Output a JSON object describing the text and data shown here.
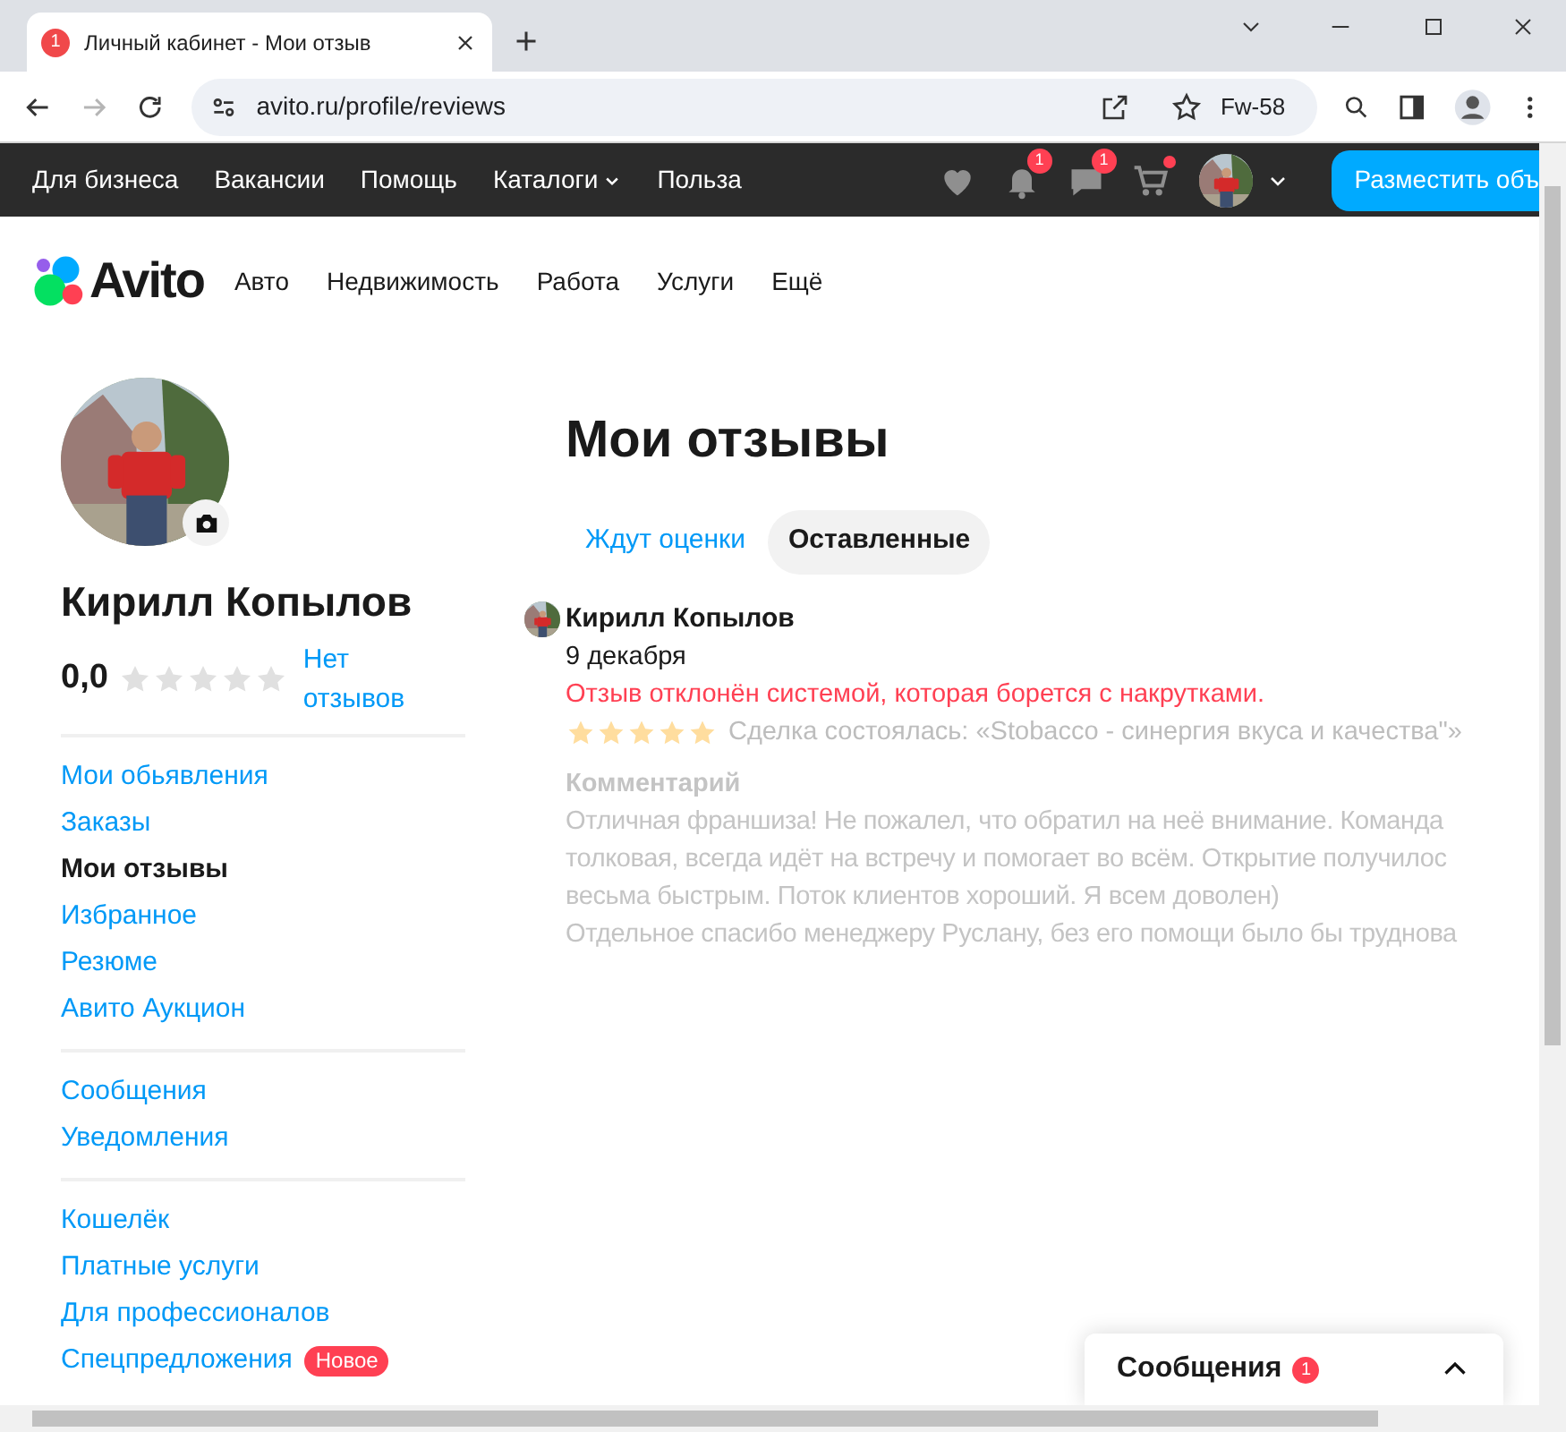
{
  "browser": {
    "tab": {
      "title": "Личный кабинет - Мои отзыв",
      "badge": "1"
    },
    "forward_disabled": true,
    "url": "avito.ru/profile/reviews",
    "profile_label": "Fw-58"
  },
  "topbar": {
    "links": [
      {
        "label": "Для бизнеса",
        "dropdown": false
      },
      {
        "label": "Вакансии",
        "dropdown": false
      },
      {
        "label": "Помощь",
        "dropdown": false
      },
      {
        "label": "Каталоги",
        "dropdown": true
      },
      {
        "label": "Польза",
        "dropdown": false
      }
    ],
    "icons": [
      {
        "kind": "heart"
      },
      {
        "kind": "bell",
        "badge": "1"
      },
      {
        "kind": "chat",
        "badge": "1"
      },
      {
        "kind": "cart",
        "dot": true
      }
    ],
    "post_button": "Разместить объ"
  },
  "header": {
    "logo": "Avito",
    "categories": [
      "Авто",
      "Недвижимость",
      "Работа",
      "Услуги",
      "Ещё"
    ]
  },
  "profile": {
    "name": "Кирилл Копылов",
    "rating": "0,0",
    "stars": 0,
    "reviews_link": "Нет отзывов"
  },
  "menu": [
    [
      {
        "label": "Мои обьявления",
        "selected": false
      },
      {
        "label": "Заказы",
        "selected": false
      },
      {
        "label": "Мои отзывы",
        "selected": true
      },
      {
        "label": "Избранное",
        "selected": false
      },
      {
        "label": "Резюме",
        "selected": false
      },
      {
        "label": "Авито Аукцион",
        "selected": false
      }
    ],
    [
      {
        "label": "Сообщения",
        "selected": false
      },
      {
        "label": "Уведомления",
        "selected": false
      }
    ],
    [
      {
        "label": "Кошелёк",
        "selected": false
      },
      {
        "label": "Платные услуги",
        "selected": false
      },
      {
        "label": "Для профессионалов",
        "selected": false
      },
      {
        "label": "Спецпредложения",
        "selected": false,
        "badge": "Новое"
      }
    ]
  ],
  "page": {
    "title": "Мои отзывы",
    "tabs": [
      {
        "label": "Ждут оценки",
        "selected": false
      },
      {
        "label": "Оставленные",
        "selected": true
      }
    ],
    "reviews": [
      {
        "author": "Кирилл Копылов",
        "date": "9 декабря",
        "status": "Отзыв отклонён системой, которая борется с накрутками.",
        "stars": 5,
        "deal": "Сделка состоялась: «Stobacco - синергия вкуса и качества\"»",
        "comment_label": "Комментарий",
        "comment_lines": [
          "Отличная франшиза! Не пожалел, что обратил на неё внимание. Команда",
          "толковая, всегда идёт на встречу и помогает во всём. Открытие получилос",
          "весьма быстрым. Поток клиентов хороший. Я всем доволен)",
          "Отдельное спасибо менеджеру Руслану, без его помощи было бы труднова"
        ]
      }
    ]
  },
  "chat_widget": {
    "label": "Сообщения",
    "badge": "1"
  }
}
